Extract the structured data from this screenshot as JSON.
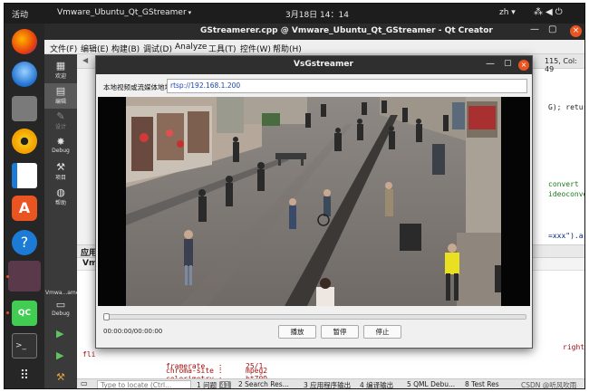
{
  "topbar": {
    "activities": "活动",
    "app_menu": "Vmware_Ubuntu_Qt_GStreamer",
    "clock": "3月18日  14：14",
    "input_method": "zh"
  },
  "dock": {
    "active_app_label": "Vmware...amer",
    "qt_label": "QC"
  },
  "qtcreator": {
    "title": "GStreamerer.cpp @ Vmware_Ubuntu_Qt_GStreamer - Qt Creator",
    "menu": [
      "文件(F)",
      "编辑(E)",
      "构建(B)",
      "调试(D)",
      "Analyze",
      "工具(T)",
      "控件(W)",
      "帮助(H)"
    ],
    "modes": [
      {
        "label": "欢迎"
      },
      {
        "label": "编辑"
      },
      {
        "label": "设计"
      },
      {
        "label": "Debug"
      },
      {
        "label": "项目"
      },
      {
        "label": "帮助"
      }
    ],
    "kit_label": "Vmwa...amer",
    "kit_mode_label": "Debug",
    "cursor_position": "115, Col: 49",
    "code_fragments": {
      "line1": "G); return",
      "line2": "convert ! g",
      "line3": "ideoconvert",
      "line4": "=xxx\").arg"
    },
    "output_pane": {
      "title": "应用",
      "subtab": "Vm",
      "right_fragment": "right-",
      "left_fragment": "fli",
      "lines": [
        {
          "key": "chroma-site :",
          "value": "mpeg2"
        },
        {
          "key": "colorimetry :",
          "value": "bt709"
        },
        {
          "key": "framerate   :",
          "value": "25/1"
        }
      ]
    },
    "statusbar": {
      "locate_placeholder": "Type to locate (Ctrl...",
      "tabs": [
        "1 问题",
        "2 Search Res...",
        "3 应用程序输出",
        "4 编译输出",
        "5 QML Debu...",
        "8 Test Res"
      ],
      "issues_badge": "41",
      "watermark": "CSDN @听风吹雨"
    }
  },
  "dialog": {
    "title": "VsGstreamer",
    "url_label": "本地视频或流媒体地址:",
    "url_value": "rtsp://192.168.1.200",
    "progress": 0,
    "timecode": "00:00:00/00:00:00",
    "buttons": {
      "play": "播放",
      "pause": "暂停",
      "stop": "停止"
    }
  }
}
